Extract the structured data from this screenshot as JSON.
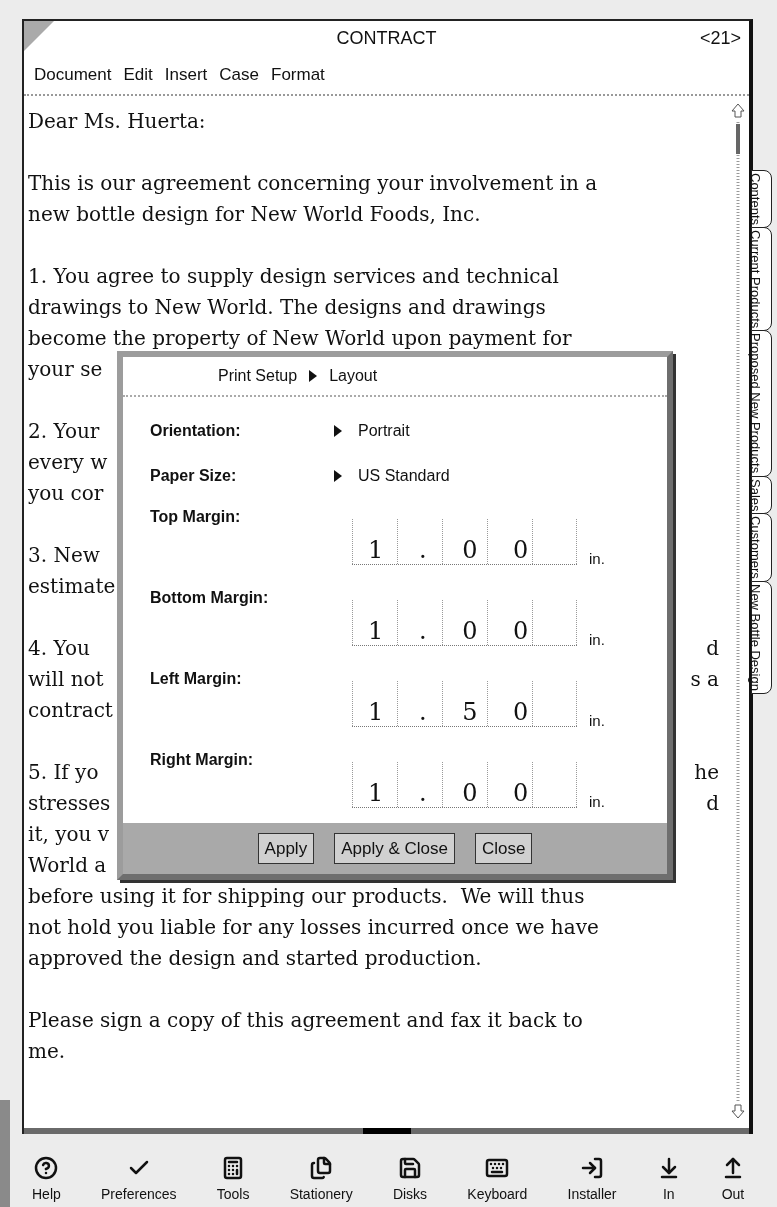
{
  "window": {
    "title": "CONTRACT",
    "page_number": "<21>"
  },
  "menu": [
    "Document",
    "Edit",
    "Insert",
    "Case",
    "Format"
  ],
  "document": {
    "paragraphs": [
      [
        {
          "left": "Dear Ms. Huerta:"
        }
      ],
      [
        {
          "left": "This is our agreement concerning your involvement in a"
        },
        {
          "left": "new bottle design for New World Foods, Inc."
        }
      ],
      [
        {
          "left": "1. You agree to supply design services and technical"
        },
        {
          "left": "drawings to New World. The designs and drawings"
        },
        {
          "left": "become the property of New World upon payment for"
        },
        {
          "left": "your se"
        }
      ],
      [
        {
          "left": "2. Your"
        },
        {
          "left": "every w"
        },
        {
          "left": "you cor"
        }
      ],
      [
        {
          "left": "3. New"
        },
        {
          "left": "estimate"
        }
      ],
      [
        {
          "left": "4. You",
          "right": "d"
        },
        {
          "left": "will not",
          "right": "s a"
        },
        {
          "left": "contract"
        }
      ],
      [
        {
          "left": "5. If yo",
          "right": "he"
        },
        {
          "left": "stresses",
          "right": "d"
        },
        {
          "left": "it, you v"
        },
        {
          "left": "World a"
        },
        {
          "left": "before using it for shipping our products.  We will thus"
        },
        {
          "left": "not hold you liable for any losses incurred once we have"
        },
        {
          "left": "approved the design and started production."
        }
      ],
      [
        {
          "left": "Please sign a copy of this agreement and fax it back to"
        },
        {
          "left": "me."
        }
      ]
    ]
  },
  "dialog": {
    "title": "Print Setup",
    "subtitle": "Layout",
    "choices": [
      {
        "label": "Orientation:",
        "value": "Portrait"
      },
      {
        "label": "Paper Size:",
        "value": "US Standard"
      }
    ],
    "margins": [
      {
        "label": "Top Margin:",
        "value": "1 . 0 0",
        "unit": "in."
      },
      {
        "label": "Bottom Margin:",
        "value": "1 . 0 0",
        "unit": "in."
      },
      {
        "label": "Left Margin:",
        "value": "1 . 5 0",
        "unit": "in."
      },
      {
        "label": "Right Margin:",
        "value": "1 . 0 0",
        "unit": "in."
      }
    ],
    "buttons": [
      "Apply",
      "Apply & Close",
      "Close"
    ]
  },
  "side_tabs": [
    "Contents",
    "Current Products",
    "Proposed New Products",
    "Sales",
    "Customers",
    "New Bottle Design"
  ],
  "toolbar": [
    "Help",
    "Preferences",
    "Tools",
    "Stationery",
    "Disks",
    "Keyboard",
    "Installer",
    "In",
    "Out"
  ]
}
